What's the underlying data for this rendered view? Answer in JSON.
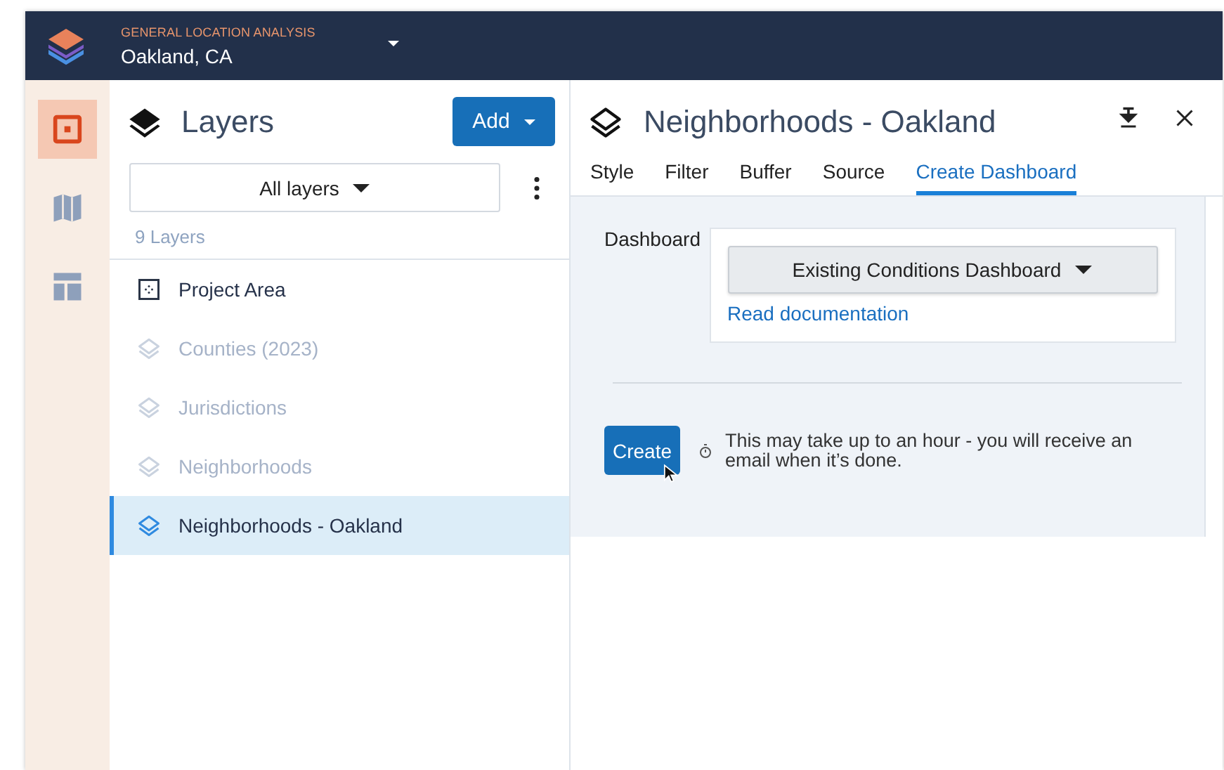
{
  "header": {
    "eyebrow": "GENERAL LOCATION ANALYSIS",
    "project": "Oakland, CA"
  },
  "rail": [
    {
      "kind": "project",
      "selected": true
    },
    {
      "kind": "map",
      "selected": false
    },
    {
      "kind": "dashboard",
      "selected": false
    }
  ],
  "layers_panel": {
    "title": "Layers",
    "add_button": "Add",
    "filter": "All layers",
    "count": "9 Layers",
    "items": [
      {
        "kind": "area",
        "label": "Project Area",
        "visible": true,
        "selected": false
      },
      {
        "kind": "layer",
        "label": "Counties (2023)",
        "visible": false,
        "selected": false
      },
      {
        "kind": "layer",
        "label": "Jurisdictions",
        "visible": false,
        "selected": false
      },
      {
        "kind": "layer",
        "label": "Neighborhoods",
        "visible": false,
        "selected": false
      },
      {
        "kind": "layer",
        "label": "Neighborhoods - Oakland",
        "visible": true,
        "selected": true
      }
    ]
  },
  "detail_panel": {
    "title": "Neighborhoods - Oakland",
    "tabs": [
      {
        "label": "Style",
        "selected": false
      },
      {
        "label": "Filter",
        "selected": false
      },
      {
        "label": "Buffer",
        "selected": false
      },
      {
        "label": "Source",
        "selected": false
      },
      {
        "label": "Create Dashboard",
        "selected": true
      }
    ],
    "dashboard_label": "Dashboard",
    "dashboard_select": "Existing Conditions Dashboard",
    "doc_link": "Read documentation",
    "create_button": "Create",
    "note": "This may take up to an hour - you will receive an email when it’s done."
  }
}
